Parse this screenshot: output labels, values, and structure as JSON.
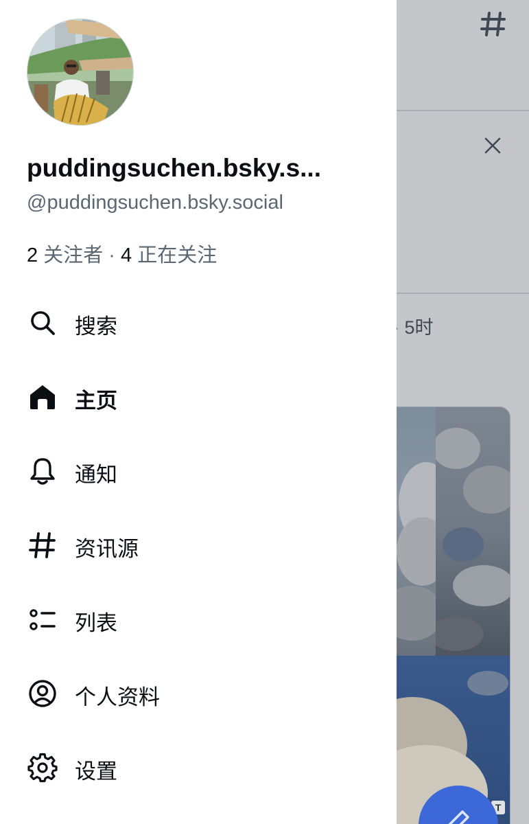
{
  "profile": {
    "display_name": "puddingsuchen.bsky.s...",
    "handle": "@puddingsuchen.bsky.social",
    "followers_count": "2",
    "followers_label": "关注者",
    "separator": "·",
    "following_count": "4",
    "following_label": "正在关注"
  },
  "menu": {
    "items": [
      {
        "label": "搜索",
        "icon": "search-icon",
        "active": false
      },
      {
        "label": "主页",
        "icon": "home-icon",
        "active": true
      },
      {
        "label": "通知",
        "icon": "bell-icon",
        "active": false
      },
      {
        "label": "资讯源",
        "icon": "hashtag-icon",
        "active": false
      },
      {
        "label": "列表",
        "icon": "list-icon",
        "active": false
      },
      {
        "label": "个人资料",
        "icon": "profile-icon",
        "active": false
      },
      {
        "label": "设置",
        "icon": "gear-icon",
        "active": false
      }
    ]
  },
  "background": {
    "post_time": "· 5时",
    "alt_badge": "T",
    "fab_icon": "compose-icon",
    "header_icon": "hashtag-icon",
    "dismiss_icon": "close-icon"
  },
  "colors": {
    "text_primary": "#0b0f14",
    "text_secondary": "#5a6773",
    "scrim": "#c4c6ca",
    "accent": "#3d68d8"
  }
}
